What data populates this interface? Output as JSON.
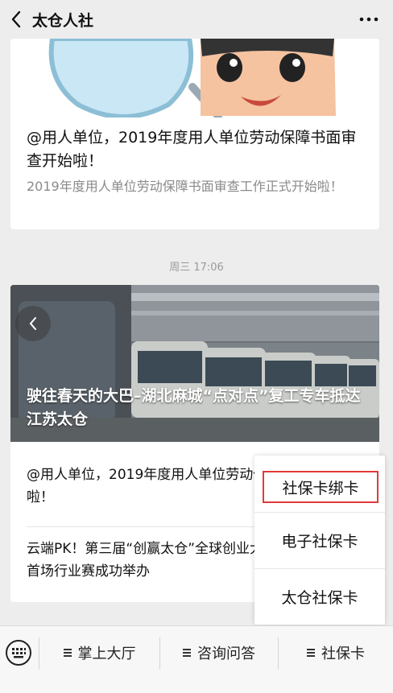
{
  "header": {
    "title": "太仓人社",
    "back_icon": "chevron-left-icon",
    "more_icon": "ellipsis-icon"
  },
  "feed": [
    {
      "headline": "@用人单位，2019年度用人单位劳动保障书面审查开始啦！",
      "summary": "2019年度用人单位劳动保障书面审查工作正式开始啦！"
    }
  ],
  "timestamp": "周三 17:06",
  "article_group": {
    "cover_title": "驶往春天的大巴–湖北麻城“点对点”复工专车抵达江苏太仓",
    "items": [
      "@用人单位，2019年度用人单位劳动保障书面审查开始啦！",
      "云端PK！第三届“创赢太仓”全球创业大赛先进载运装备首场行业赛成功举办"
    ]
  },
  "popup_menu": {
    "items": [
      "社保卡绑卡",
      "电子社保卡",
      "太仓社保卡"
    ],
    "selected_index": 0,
    "highlight_color": "#e03a3a"
  },
  "bottom_menu": {
    "keyboard_icon": "keyboard-icon",
    "tabs": [
      "掌上大厅",
      "咨询问答",
      "社保卡"
    ]
  }
}
